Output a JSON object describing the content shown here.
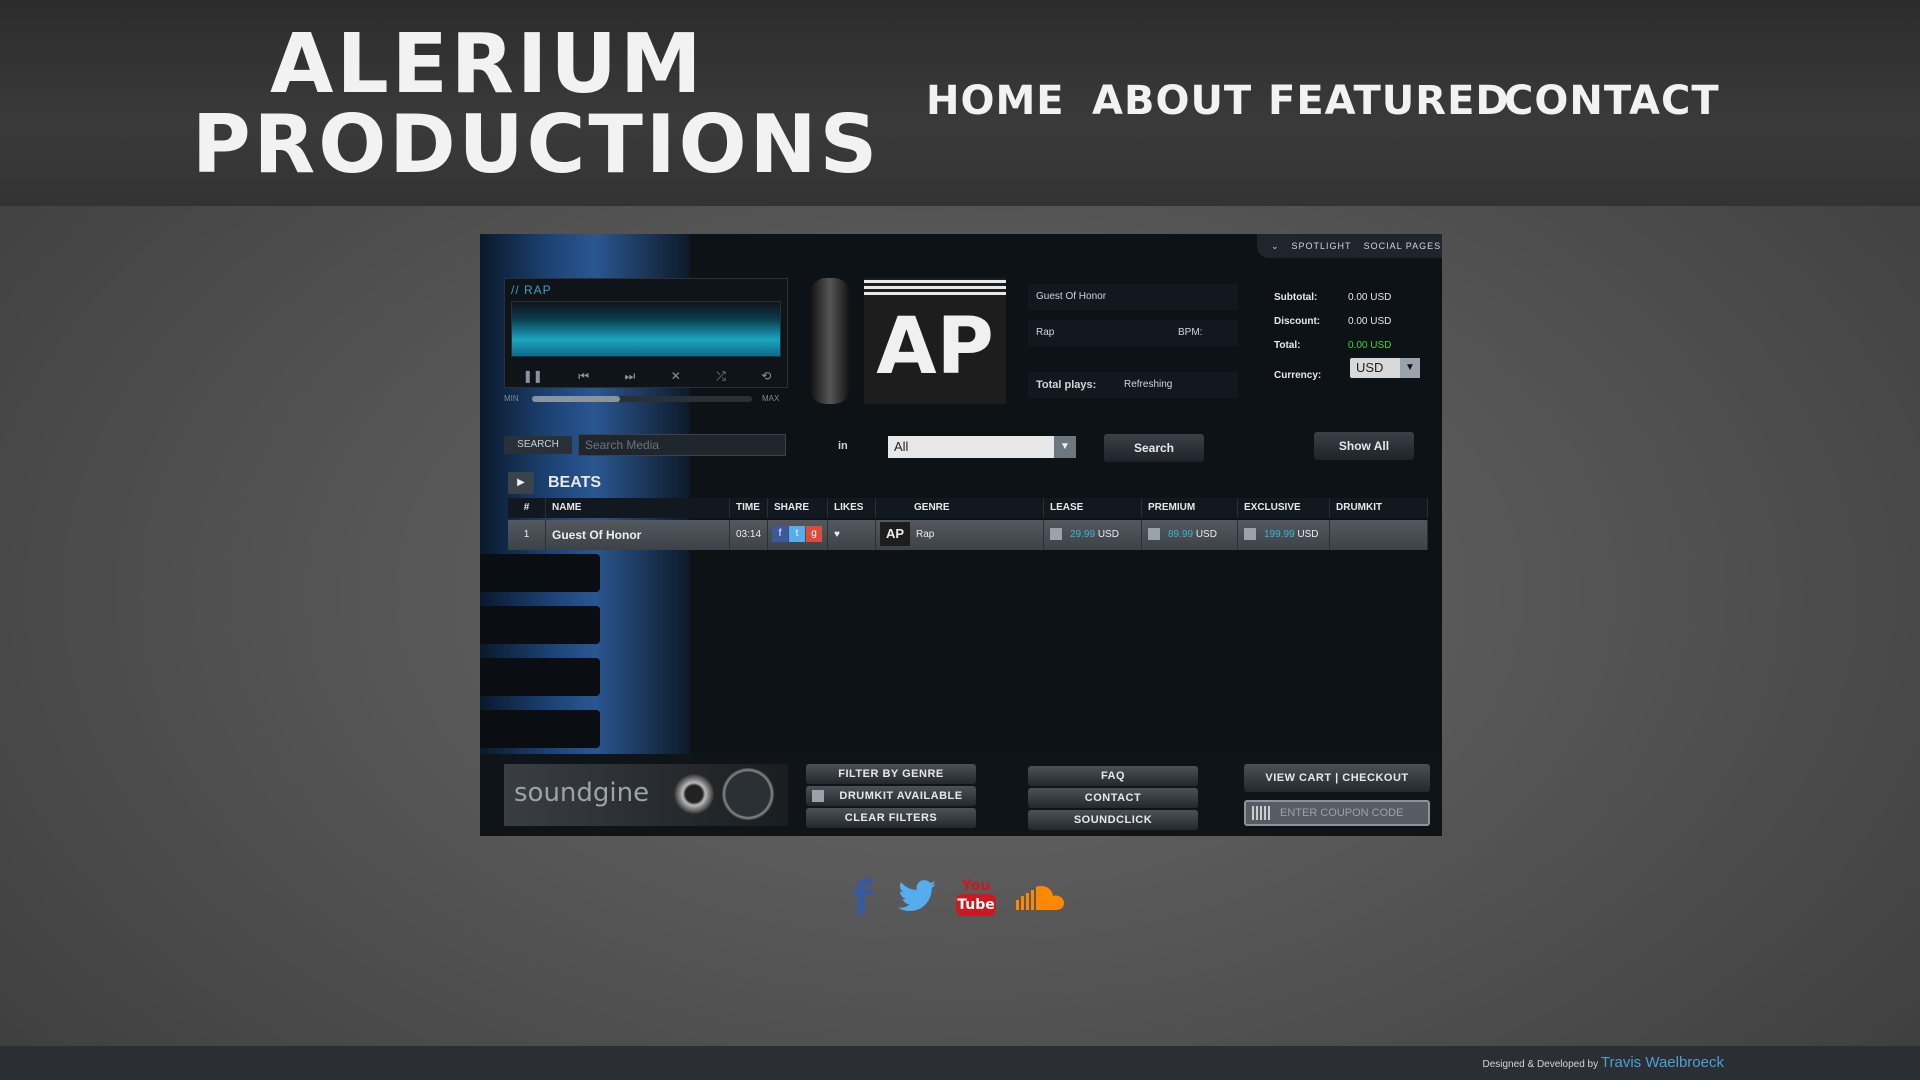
{
  "header": {
    "logo_line1": "ALERIUM",
    "logo_line2": "PRODUCTIONS",
    "nav": [
      "HOME",
      "ABOUT",
      "FEATURED",
      "CONTACT"
    ]
  },
  "player": {
    "top_tabs": [
      "SPOTLIGHT",
      "SOCIAL PAGES"
    ],
    "visualizer_genre": "// RAP",
    "volume_min": "MIN",
    "volume_max": "MAX",
    "volume_level": 0.4,
    "album_art_text": "AP",
    "now_playing": {
      "title": "Guest Of Honor",
      "genre": "Rap",
      "bpm_label": "BPM:",
      "plays_label": "Total plays:",
      "plays_value": "Refreshing"
    },
    "cart": {
      "subtotal_label": "Subtotal:",
      "subtotal_value": "0.00 USD",
      "discount_label": "Discount:",
      "discount_value": "0.00 USD",
      "total_label": "Total:",
      "total_value": "0.00 USD",
      "currency_label": "Currency:",
      "currency_value": "USD"
    },
    "search": {
      "label": "SEARCH",
      "placeholder": "Search Media",
      "in_label": "in",
      "in_value": "All",
      "search_button": "Search",
      "show_all_button": "Show All"
    },
    "section_label": "BEATS",
    "table": {
      "headers": [
        "#",
        "NAME",
        "TIME",
        "SHARE",
        "LIKES",
        "GENRE",
        "LEASE",
        "PREMIUM",
        "EXCLUSIVE",
        "DRUMKIT"
      ],
      "rows": [
        {
          "num": "1",
          "name": "Guest Of Honor",
          "time": "03:14",
          "genre": "Rap",
          "art": "AP",
          "lease_price": "29.99",
          "premium_price": "89.99",
          "exclusive_price": "199.99",
          "currency": "USD"
        }
      ]
    },
    "bottom": {
      "brand": "soundgine",
      "filter_genre": "FILTER BY GENRE",
      "drumkit_available": "DRUMKIT AVAILABLE",
      "clear_filters": "CLEAR FILTERS",
      "faq": "FAQ",
      "contact": "CONTACT",
      "soundclick": "SOUNDCLICK",
      "view_cart": "VIEW CART | CHECKOUT",
      "coupon_placeholder": "ENTER COUPON CODE"
    }
  },
  "socials": {
    "facebook": "f",
    "youtube_top": "You",
    "youtube_bottom": "Tube"
  },
  "footer": {
    "credit_prefix": "Designed & Developed by",
    "credit_name": "Travis Waelbroeck"
  },
  "colors": {
    "accent_blue": "#39b6d8",
    "total_green": "#3ad83a",
    "facebook": "#3b5998",
    "twitter": "#55acee",
    "youtube": "#cc181e",
    "soundcloud": "#ff8800"
  }
}
